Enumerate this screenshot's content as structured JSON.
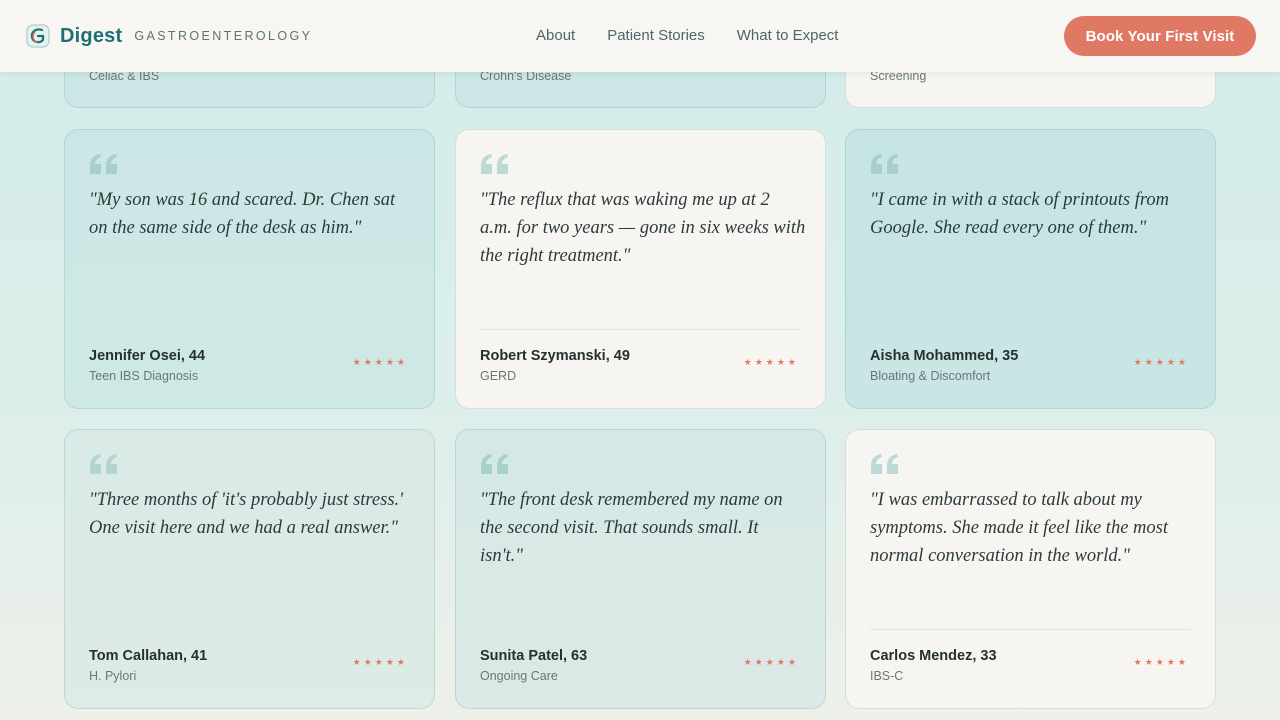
{
  "header": {
    "brand_name": "Digest",
    "brand_tag": "GASTROENTEROLOGY",
    "nav": [
      "About",
      "Patient Stories",
      "What to Expect"
    ],
    "cta_label": "Book Your First Visit"
  },
  "colors": {
    "brand": "#1f6f74",
    "accent": "#e07963",
    "card_teal": "#cfe7e6",
    "card_light": "#f6f5f1"
  },
  "partial_cards": [
    {
      "condition": "Celiac & IBS"
    },
    {
      "condition": "Crohn's Disease"
    },
    {
      "condition": "Screening"
    }
  ],
  "testimonials": [
    {
      "quote": "\"My son was 16 and scared. Dr. Chen sat on the same side of the desk as him.\"",
      "author": "Jennifer Osei, 44",
      "condition": "Teen IBS Diagnosis",
      "stars": "★★★★★"
    },
    {
      "quote": "\"The reflux that was waking me up at 2 a.m. for two years — gone in six weeks with the right treatment.\"",
      "author": "Robert Szymanski, 49",
      "condition": "GERD",
      "stars": "★★★★★"
    },
    {
      "quote": "\"I came in with a stack of printouts from Google. She read every one of them.\"",
      "author": "Aisha Mohammed, 35",
      "condition": "Bloating & Discomfort",
      "stars": "★★★★★"
    },
    {
      "quote": "\"Three months of 'it's probably just stress.' One visit here and we had a real answer.\"",
      "author": "Tom Callahan, 41",
      "condition": "H. Pylori",
      "stars": "★★★★★"
    },
    {
      "quote": "\"The front desk remembered my name on the second visit. That sounds small. It isn't.\"",
      "author": "Sunita Patel, 63",
      "condition": "Ongoing Care",
      "stars": "★★★★★"
    },
    {
      "quote": "\"I was embarrassed to talk about my symptoms. She made it feel like the most normal conversation in the world.\"",
      "author": "Carlos Mendez, 33",
      "condition": "IBS-C",
      "stars": "★★★★★"
    }
  ]
}
